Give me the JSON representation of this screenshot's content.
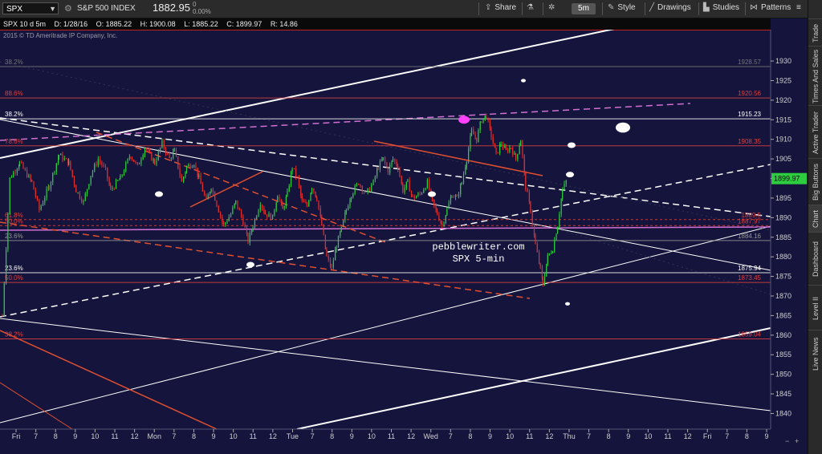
{
  "toolbar": {
    "symbol": "SPX",
    "index_name": "S&P 500 INDEX",
    "price": "1882.95",
    "change_top": "0",
    "change_bottom": "0.00%",
    "share": "Share",
    "aggregation": "5m",
    "style": "Style",
    "drawings": "Drawings",
    "studies": "Studies",
    "patterns": "Patterns",
    "icons": [
      "settings-icon",
      "share-icon",
      "beaker-icon",
      "gear-icon",
      "style-icon",
      "drawings-icon",
      "studies-icon",
      "patterns-icon",
      "menu-icon"
    ]
  },
  "infobar": {
    "spec": "SPX 10 d 5m",
    "date": "D: 1/28/16",
    "open": "O: 1885.22",
    "high": "H: 1900.08",
    "low": "L: 1885.22",
    "close": "C: 1899.97",
    "range": "R: 14.86"
  },
  "copyright": "2015 © TD Ameritrade IP Company, Inc.",
  "watermark": [
    "pebblewriter.com",
    "SPX 5-min"
  ],
  "right_tabs": [
    "Trade",
    "Times And Sales",
    "Active Trader",
    "Big Buttons",
    "Chart",
    "Dashboard",
    "Level II",
    "Live News"
  ],
  "chart_data": {
    "type": "candlestick",
    "symbol": "SPX",
    "interval": "5m",
    "ylim": [
      1836,
      1938
    ],
    "y_ticks": [
      1840,
      1845,
      1850,
      1855,
      1860,
      1865,
      1870,
      1875,
      1880,
      1885,
      1890,
      1895,
      1900,
      1905,
      1910,
      1915,
      1920,
      1925,
      1930
    ],
    "x_tick_labels": [
      "Fri",
      "7",
      "8",
      "9",
      "10",
      "11",
      "12",
      "Mon",
      "7",
      "8",
      "9",
      "10",
      "11",
      "12",
      "Tue",
      "7",
      "8",
      "9",
      "10",
      "11",
      "12",
      "Wed",
      "7",
      "8",
      "9",
      "10",
      "11",
      "12",
      "Thu",
      "7",
      "8",
      "9",
      "10",
      "11",
      "12",
      "Fri",
      "7",
      "8",
      "9"
    ],
    "last_price": 1899.97,
    "last_price_label": "1899.97",
    "fib_levels": [
      {
        "pct": "38.2%",
        "value": "1928.57",
        "color": "#777777",
        "price": 1928.57
      },
      {
        "pct": "88.6%",
        "value": "1920.56",
        "color": "#e04040",
        "price": 1920.56
      },
      {
        "pct": "38.2%",
        "value": "1915.23",
        "color": "#ffffff",
        "price": 1915.23
      },
      {
        "pct": "78.6%",
        "value": "1908.35",
        "color": "#e04040",
        "price": 1908.35
      },
      {
        "pct": "61.8%",
        "value": "1889.5",
        "color": "#e04040",
        "price": 1889.5
      },
      {
        "pct": "50.0%",
        "value": "1887.97",
        "color": "#e04040",
        "price": 1887.97
      },
      {
        "pct": "23.6%",
        "value": "1884.16",
        "color": "#999999",
        "price": 1884.16
      },
      {
        "pct": "23.6%",
        "value": "1875.94",
        "color": "#ffffff",
        "price": 1875.94
      },
      {
        "pct": "50.0%",
        "value": "1873.45",
        "color": "#e04040",
        "price": 1873.45
      },
      {
        "pct": "38.2%",
        "value": "1859.04",
        "color": "#e04040",
        "price": 1859.04
      }
    ],
    "price_path": [
      [
        0,
        1865
      ],
      [
        6,
        1900
      ],
      [
        14,
        1904
      ],
      [
        20,
        1901
      ],
      [
        24,
        1899
      ],
      [
        30,
        1892
      ],
      [
        38,
        1898
      ],
      [
        46,
        1906
      ],
      [
        54,
        1904
      ],
      [
        60,
        1897
      ],
      [
        66,
        1894
      ],
      [
        72,
        1901
      ],
      [
        78,
        1905
      ],
      [
        84,
        1902
      ],
      [
        88,
        1897
      ],
      [
        96,
        1900
      ],
      [
        104,
        1906
      ],
      [
        110,
        1903
      ],
      [
        116,
        1908
      ],
      [
        120,
        1906
      ],
      [
        124,
        1904
      ],
      [
        130,
        1909
      ],
      [
        136,
        1905
      ],
      [
        140,
        1907
      ],
      [
        146,
        1899
      ],
      [
        150,
        1903
      ],
      [
        156,
        1904
      ],
      [
        160,
        1900
      ],
      [
        166,
        1894
      ],
      [
        170,
        1898
      ],
      [
        176,
        1892
      ],
      [
        180,
        1888
      ],
      [
        186,
        1891
      ],
      [
        190,
        1894
      ],
      [
        196,
        1889
      ],
      [
        200,
        1884
      ],
      [
        204,
        1888
      ],
      [
        210,
        1894
      ],
      [
        214,
        1891
      ],
      [
        220,
        1890
      ],
      [
        224,
        1896
      ],
      [
        228,
        1892
      ],
      [
        232,
        1896
      ],
      [
        236,
        1903
      ],
      [
        240,
        1900
      ],
      [
        244,
        1894
      ],
      [
        248,
        1893
      ],
      [
        252,
        1898
      ],
      [
        256,
        1895
      ],
      [
        260,
        1888
      ],
      [
        264,
        1880
      ],
      [
        268,
        1877
      ],
      [
        272,
        1883
      ],
      [
        276,
        1887
      ],
      [
        280,
        1892
      ],
      [
        284,
        1896
      ],
      [
        290,
        1899
      ],
      [
        296,
        1896
      ],
      [
        302,
        1899
      ],
      [
        306,
        1903
      ],
      [
        310,
        1905
      ],
      [
        314,
        1902
      ],
      [
        318,
        1905
      ],
      [
        322,
        1903
      ],
      [
        326,
        1897
      ],
      [
        330,
        1899
      ],
      [
        334,
        1895
      ],
      [
        340,
        1896
      ],
      [
        346,
        1899
      ],
      [
        350,
        1894
      ],
      [
        354,
        1891
      ],
      [
        358,
        1888
      ],
      [
        362,
        1892
      ],
      [
        366,
        1896
      ],
      [
        370,
        1895
      ],
      [
        374,
        1899
      ],
      [
        378,
        1905
      ],
      [
        382,
        1912
      ],
      [
        386,
        1910
      ],
      [
        390,
        1915
      ],
      [
        394,
        1916
      ],
      [
        398,
        1911
      ],
      [
        402,
        1906
      ],
      [
        406,
        1909
      ],
      [
        410,
        1907
      ],
      [
        414,
        1908
      ],
      [
        418,
        1905
      ],
      [
        422,
        1910
      ],
      [
        426,
        1898
      ],
      [
        430,
        1892
      ],
      [
        434,
        1883
      ],
      [
        438,
        1877
      ],
      [
        440,
        1873
      ],
      [
        444,
        1880
      ],
      [
        448,
        1882
      ],
      [
        452,
        1888
      ],
      [
        456,
        1897
      ],
      [
        460,
        1900
      ]
    ],
    "marked_points": [
      1925,
      1913,
      1915,
      1908.5,
      1901,
      1896,
      1896,
      1878,
      1868
    ]
  }
}
